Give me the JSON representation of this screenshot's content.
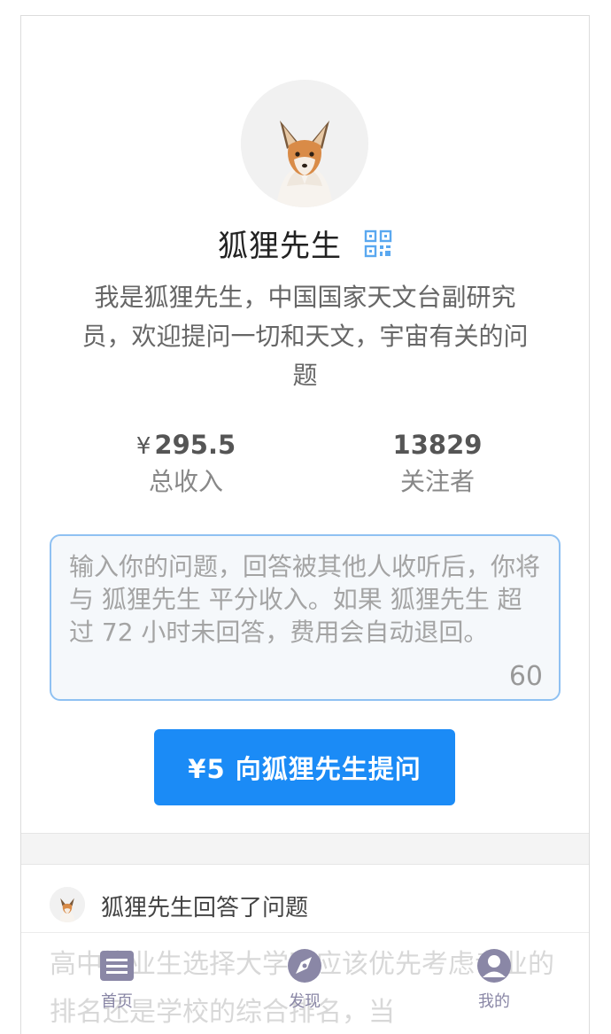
{
  "profile": {
    "name": "狐狸先生",
    "bio": "我是狐狸先生，中国国家天文台副研究员，欢迎提问一切和天文，宇宙有关的问题",
    "stats": {
      "income_currency": "¥",
      "income_value": "295.5",
      "income_label": "总收入",
      "followers_value": "13829",
      "followers_label": "关注者"
    }
  },
  "question_form": {
    "placeholder": "输入你的问题，回答被其他人收听后，你将与 狐狸先生 平分收入。如果 狐狸先生 超过 72 小时未回答，费用会自动退回。",
    "value": "",
    "char_counter": "60",
    "ask_button_label": "¥5 向狐狸先生提问"
  },
  "feed": {
    "item_title": "狐狸先生回答了问题",
    "item_text": "高中毕业生选择大学时应该优先考虑专业的排名还是学校的综合排名，当"
  },
  "tabbar": {
    "items": [
      {
        "label": "首页",
        "icon": "home-list-icon"
      },
      {
        "label": "发现",
        "icon": "compass-icon"
      },
      {
        "label": "我的",
        "icon": "user-icon"
      }
    ],
    "color": "#8a87a6"
  },
  "colors": {
    "accent": "#1b8bf6",
    "input_border": "#8fc1f2",
    "qr_icon": "#5aa8f0"
  }
}
